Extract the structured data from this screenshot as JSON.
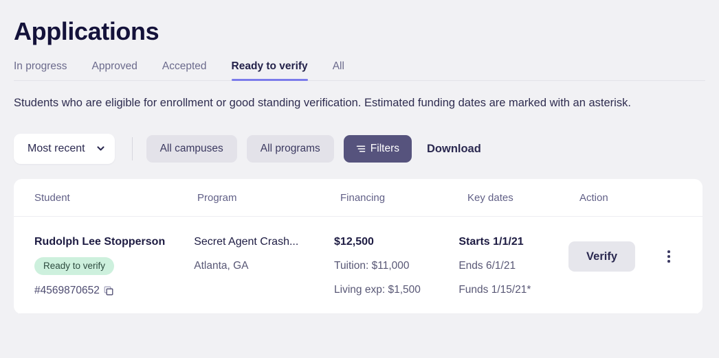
{
  "page": {
    "title": "Applications",
    "description": "Students who are eligible for enrollment or good standing verification. Estimated funding dates are marked with an asterisk."
  },
  "tabs": [
    {
      "label": "In progress",
      "active": false
    },
    {
      "label": "Approved",
      "active": false
    },
    {
      "label": "Accepted",
      "active": false
    },
    {
      "label": "Ready to verify",
      "active": true
    },
    {
      "label": "All",
      "active": false
    }
  ],
  "toolbar": {
    "sort_value": "Most recent",
    "sort_icon": "chevron-down-icon",
    "campus_filter": "All campuses",
    "program_filter": "All programs",
    "filters_label": "Filters",
    "filters_icon": "filter-icon",
    "download_label": "Download"
  },
  "table": {
    "columns": [
      "Student",
      "Program",
      "Financing",
      "Key dates",
      "Action"
    ],
    "rows": [
      {
        "student_name": "Rudolph Lee Stopperson",
        "status_badge": "Ready to verify",
        "application_id": "#4569870652",
        "copy_icon": "copy-icon",
        "program_name": "Secret Agent Crash...",
        "program_location": "Atlanta, GA",
        "financing_total": "$12,500",
        "financing_tuition": "Tuition: $11,000",
        "financing_living": "Living exp: $1,500",
        "date_starts": "Starts 1/1/21",
        "date_ends": "Ends 6/1/21",
        "date_funds": "Funds 1/15/21*",
        "action_label": "Verify",
        "menu_icon": "kebab-menu-icon"
      }
    ]
  },
  "colors": {
    "page_background": "#f1f1f4",
    "accent_underline": "#7b7bea",
    "filters_button": "#56537d",
    "badge_background": "#cdf0dd",
    "title": "#14123a"
  }
}
